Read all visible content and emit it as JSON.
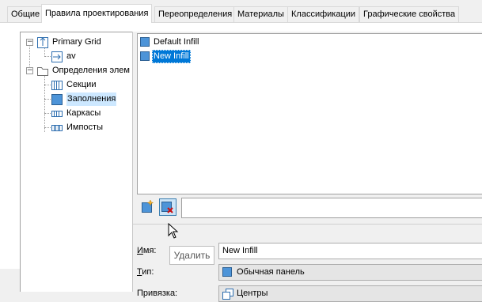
{
  "tabs": [
    {
      "label": "Общие",
      "active": false
    },
    {
      "label": "Правила проектирования",
      "active": true
    },
    {
      "label": "Переопределения",
      "active": false
    },
    {
      "label": "Материалы",
      "active": false
    },
    {
      "label": "Классификации",
      "active": false
    },
    {
      "label": "Графические свойства",
      "active": false
    }
  ],
  "tree": {
    "items": [
      {
        "label": "Primary Grid",
        "icon": "grid-icon"
      },
      {
        "label": "av",
        "icon": "grid-child-icon"
      },
      {
        "label": "Определения элем",
        "icon": "folder-icon"
      },
      {
        "label": "Секции",
        "icon": "sections-icon"
      },
      {
        "label": "Заполнения",
        "icon": "infill-icon",
        "selected": true
      },
      {
        "label": "Каркасы",
        "icon": "frames-icon"
      },
      {
        "label": "Импосты",
        "icon": "mullions-icon"
      }
    ]
  },
  "list": {
    "items": [
      {
        "label": "Default Infill",
        "selected": false
      },
      {
        "label": "New Infill",
        "selected": true
      }
    ]
  },
  "toolbar": {
    "add_icon": "add-infill-icon",
    "delete_icon": "delete-infill-icon"
  },
  "props": {
    "name_label_underlined": "И",
    "name_label_rest": "мя:",
    "name_value": "New Infill",
    "tooltip": "Удалить",
    "type_label_underlined": "Т",
    "type_label_rest": "ип:",
    "type_value": "Обычная панель",
    "binding_label": "Привязка:",
    "binding_value": "Центры"
  },
  "colors": {
    "selection": "#0078d7",
    "tree_selection": "#cde8ff",
    "infill_square": "#4d94d8"
  }
}
